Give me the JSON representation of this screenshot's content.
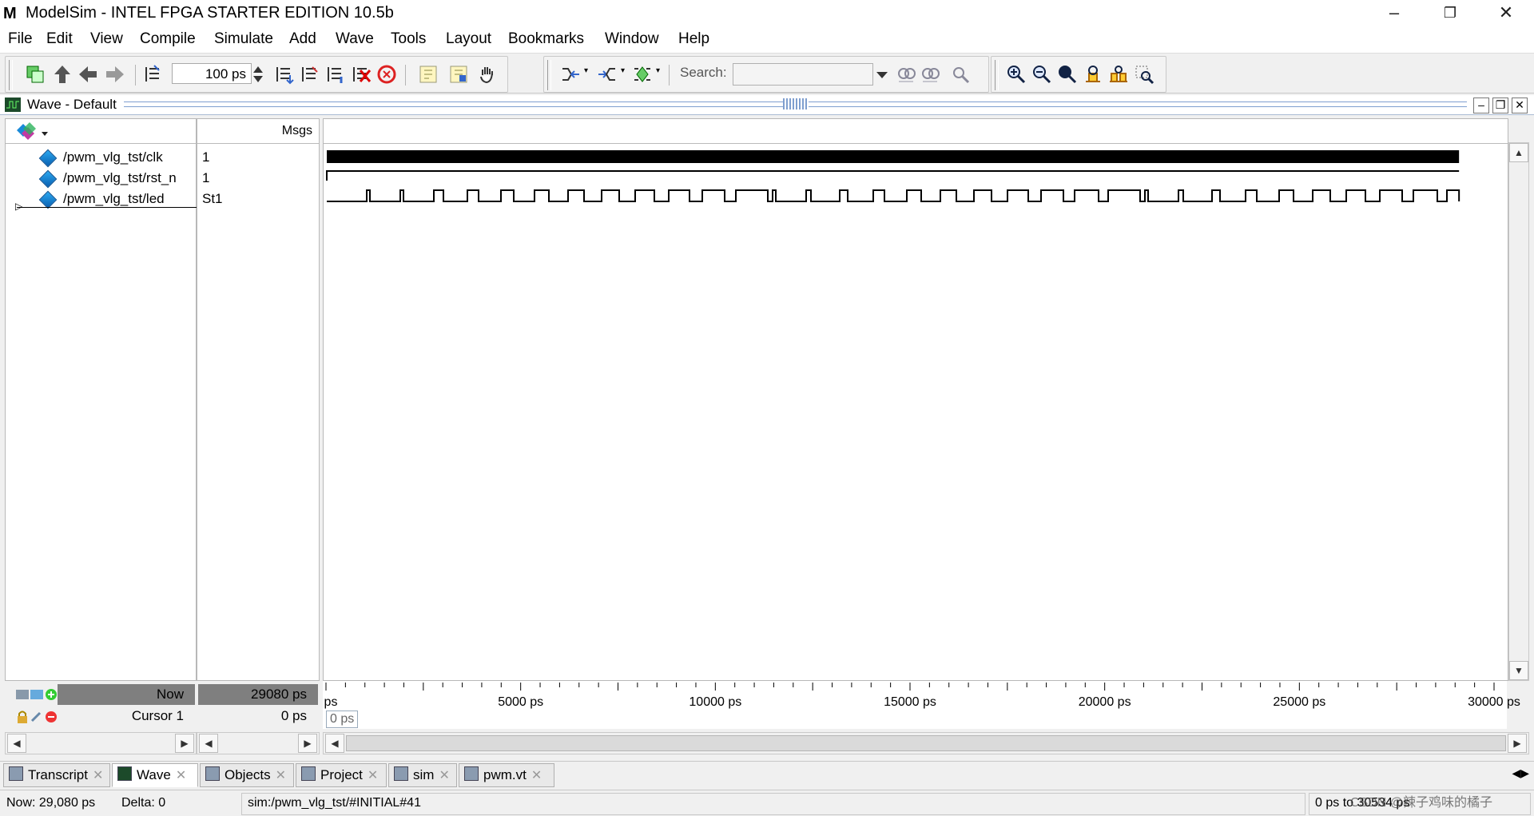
{
  "window": {
    "title": "ModelSim - INTEL FPGA STARTER EDITION 10.5b",
    "logo_letter": "M"
  },
  "menu": [
    "File",
    "Edit",
    "View",
    "Compile",
    "Simulate",
    "Add",
    "Wave",
    "Tools",
    "Layout",
    "Bookmarks",
    "Window",
    "Help"
  ],
  "toolbar": {
    "run_length_value": "100 ps",
    "search_label": "Search:",
    "search_value": ""
  },
  "wave": {
    "panel_title": "Wave - Default",
    "msgs_header": "Msgs",
    "signals": [
      {
        "name": "/pwm_vlg_tst/clk",
        "value": "1"
      },
      {
        "name": "/pwm_vlg_tst/rst_n",
        "value": "1"
      },
      {
        "name": "/pwm_vlg_tst/led",
        "value": "St1"
      }
    ],
    "now_label": "Now",
    "now_value": "29080 ps",
    "cursor_label": "Cursor 1",
    "cursor_value": "0 ps",
    "cursor_flag": "0 ps",
    "axis_start_label": "ps",
    "axis_ticks": [
      "5000 ps",
      "10000 ps",
      "15000 ps",
      "20000 ps",
      "25000 ps",
      "30000 ps"
    ],
    "axis_max_ps": 30000,
    "sim_end_ps": 29080
  },
  "tabs": [
    {
      "label": "Transcript",
      "icon": "transcript-icon",
      "active": false
    },
    {
      "label": "Wave",
      "icon": "wave-icon",
      "active": true
    },
    {
      "label": "Objects",
      "icon": "objects-icon",
      "active": false
    },
    {
      "label": "Project",
      "icon": "project-icon",
      "active": false
    },
    {
      "label": "sim",
      "icon": "sim-icon",
      "active": false
    },
    {
      "label": "pwm.vt",
      "icon": "file-icon",
      "active": false
    }
  ],
  "status": {
    "now": "Now: 29,080 ps",
    "delta": "Delta: 0",
    "context": "sim:/pwm_vlg_tst/#INITIAL#41",
    "range": "0 ps to 30534 ps",
    "watermark": "CSDN @辣子鸡味的橘子"
  }
}
